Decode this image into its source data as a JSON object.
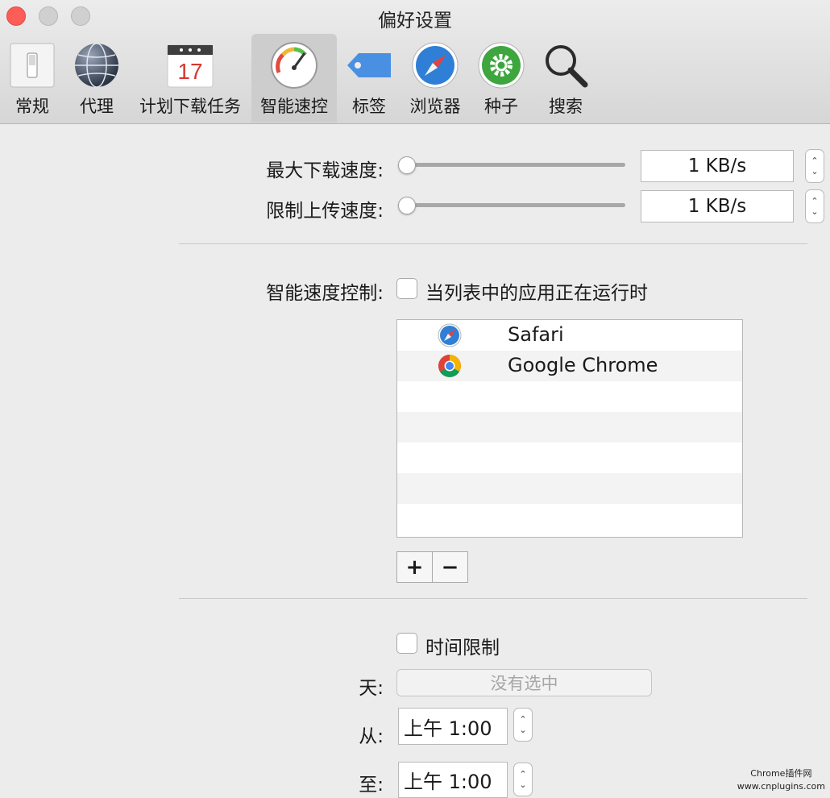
{
  "window": {
    "title": "偏好设置"
  },
  "toolbar": {
    "tabs": [
      {
        "label": "常规",
        "icon": "switch-icon"
      },
      {
        "label": "代理",
        "icon": "globe-icon"
      },
      {
        "label": "计划下载任务",
        "icon": "calendar-icon",
        "calendar_day": "17"
      },
      {
        "label": "智能速控",
        "icon": "speedometer-icon",
        "selected": true
      },
      {
        "label": "标签",
        "icon": "tag-icon"
      },
      {
        "label": "浏览器",
        "icon": "compass-icon"
      },
      {
        "label": "种子",
        "icon": "gear-icon"
      },
      {
        "label": "搜索",
        "icon": "magnifier-icon"
      }
    ]
  },
  "speed": {
    "max_download_label": "最大下载速度:",
    "max_download_value": "1 KB/s",
    "max_download_slider_fraction": 0,
    "upload_limit_label": "限制上传速度:",
    "upload_limit_value": "1 KB/s",
    "upload_limit_slider_fraction": 0
  },
  "smart_control": {
    "label": "智能速度控制:",
    "checkbox_label": "当列表中的应用正在运行时",
    "checked": false,
    "apps": [
      {
        "name": "Safari",
        "icon": "safari-icon"
      },
      {
        "name": "Google Chrome",
        "icon": "chrome-icon"
      }
    ],
    "add_label": "+",
    "remove_label": "−"
  },
  "time_limit": {
    "checkbox_label": "时间限制",
    "checked": false,
    "day_label": "天:",
    "day_value": "没有选中",
    "from_label": "从:",
    "from_value": "上午  1:00",
    "to_label": "至:",
    "to_value": "上午  1:00"
  },
  "watermark": {
    "line1": "Chrome插件网",
    "line2": "www.cnplugins.com"
  },
  "colors": {
    "close": "#fc5e57",
    "tag": "#4a90e2",
    "gear": "#3ea63e"
  }
}
